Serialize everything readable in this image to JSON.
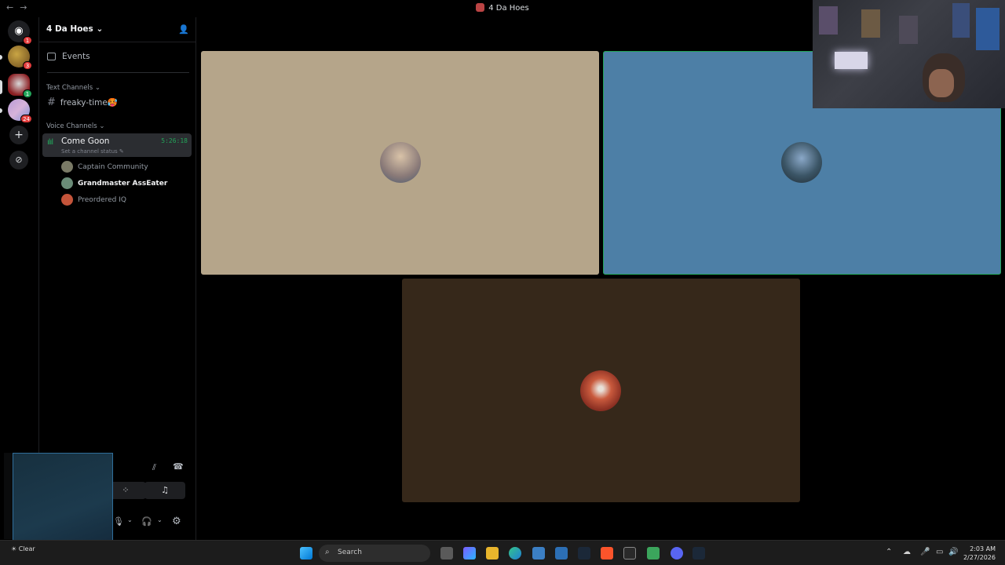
{
  "titlebar": {
    "back": "←",
    "forward": "→",
    "title": "4 Da Hoes"
  },
  "servers": [
    {
      "name": "direct-messages",
      "badge": "1",
      "badge_color": "red"
    },
    {
      "name": "server-1",
      "badge": "3",
      "badge_color": "red"
    },
    {
      "name": "server-2",
      "badge": "1",
      "badge_color": "green"
    },
    {
      "name": "server-3",
      "badge": "24",
      "badge_color": "red"
    }
  ],
  "server_actions": {
    "add": "+",
    "discover": "⊘"
  },
  "guild": {
    "name": "4 Da Hoes",
    "chevron": "⌄"
  },
  "events_label": "Events",
  "text_category": "Text Channels",
  "text_channels": [
    {
      "name": "freaky-time",
      "emoji": "🥵"
    }
  ],
  "voice_category": "Voice Channels",
  "voice_channel": {
    "name": "Come Goon",
    "status": "Set a channel status",
    "timer": "5:26:18"
  },
  "voice_users": [
    {
      "name": "Captain Community",
      "bold": false,
      "avatar_color": "#7a7a66"
    },
    {
      "name": "Grandmaster AssEater",
      "bold": true,
      "avatar_color": "#6b8c78"
    },
    {
      "name": "Preordered IQ",
      "bold": false,
      "avatar_color": "#c4543a"
    }
  ],
  "tiles": [
    {
      "name": "tile-captain-community",
      "bg": "#b5a58a",
      "avatar": "#8a7a78"
    },
    {
      "name": "tile-grandmaster",
      "bg": "#4d7fa6",
      "avatar": "#3b5566",
      "speaking": true
    },
    {
      "name": "tile-preordered-iq",
      "bg": "#36281a",
      "avatar": "#c95a3d"
    }
  ],
  "taskbar": {
    "search_placeholder": "Search",
    "weather": "Clear",
    "time": "2:03 AM",
    "date": "2/27/2026"
  }
}
